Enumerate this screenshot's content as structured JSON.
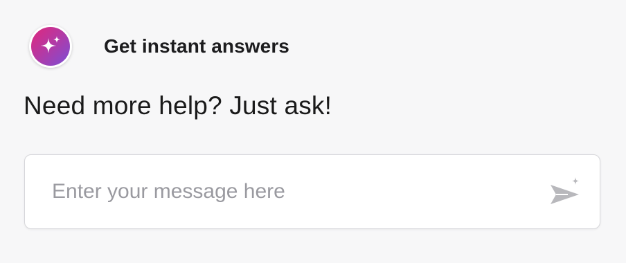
{
  "header": {
    "title": "Get instant answers",
    "icon": "sparkle-icon"
  },
  "prompt": {
    "text": "Need more help? Just ask!"
  },
  "input": {
    "value": "",
    "placeholder": "Enter your message here",
    "send_icon": "send-sparkle-icon"
  },
  "colors": {
    "avatar_gradient_start": "#e0277c",
    "avatar_gradient_end": "#7a4fd6",
    "send_icon": "#b8b8bc"
  }
}
